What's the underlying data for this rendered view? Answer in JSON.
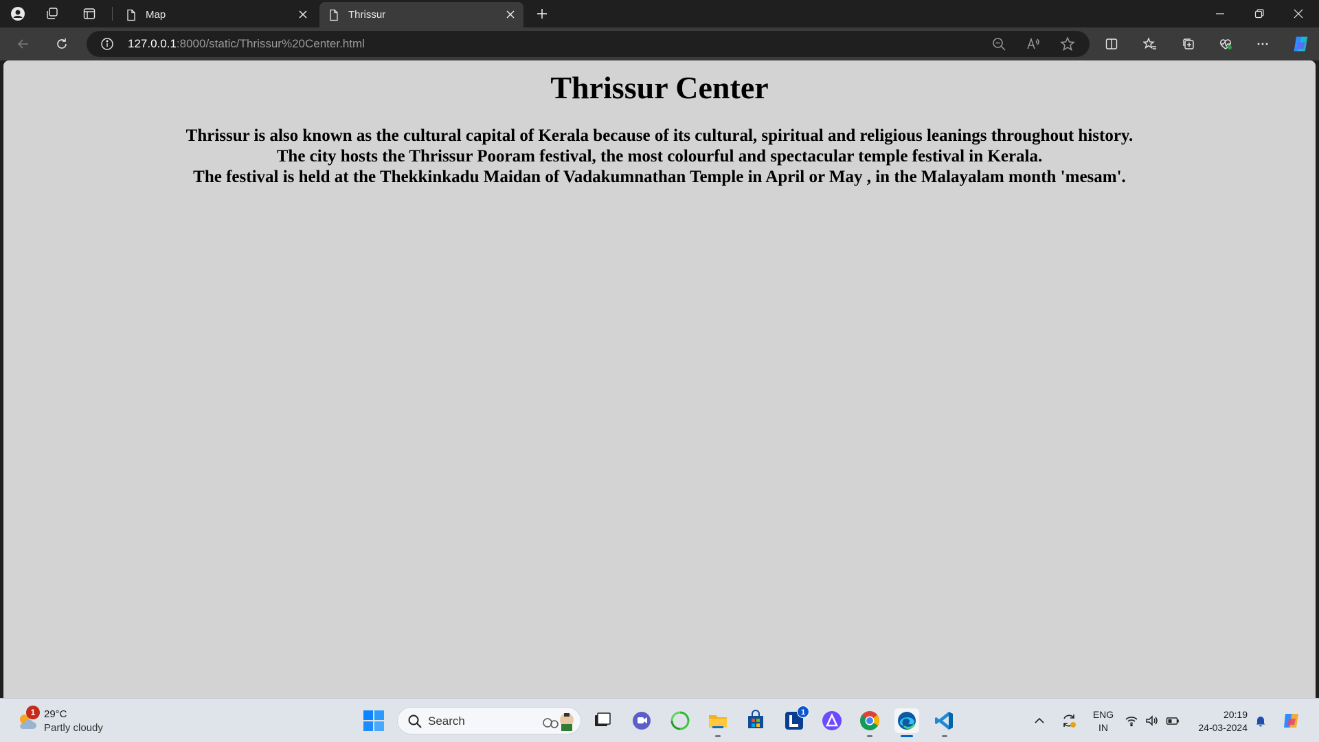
{
  "browser": {
    "tabs": [
      {
        "title": "Map",
        "active": false
      },
      {
        "title": "Thrissur",
        "active": true
      }
    ],
    "address": {
      "host": "127.0.0.1",
      "rest": ":8000/static/Thrissur%20Center.html"
    }
  },
  "page": {
    "title": "Thrissur Center",
    "lines": [
      "Thrissur is also known as the cultural capital of Kerala because of its cultural, spiritual and religious leanings throughout history.",
      "The city hosts the Thrissur Pooram festival, the most colourful and spectacular temple festival in Kerala.",
      "The festival is held at the Thekkinkadu Maidan of Vadakumnathan Temple in April or May , in the Malayalam month 'mesam'."
    ],
    "background": "#d3d3d3"
  },
  "taskbar": {
    "weather": {
      "temp": "29°C",
      "condition": "Partly cloudy",
      "badge": "1"
    },
    "search_label": "Search",
    "app_badge": "1",
    "lang": {
      "line1": "ENG",
      "line2": "IN"
    },
    "clock": {
      "time": "20:19",
      "date": "24-03-2024"
    }
  }
}
